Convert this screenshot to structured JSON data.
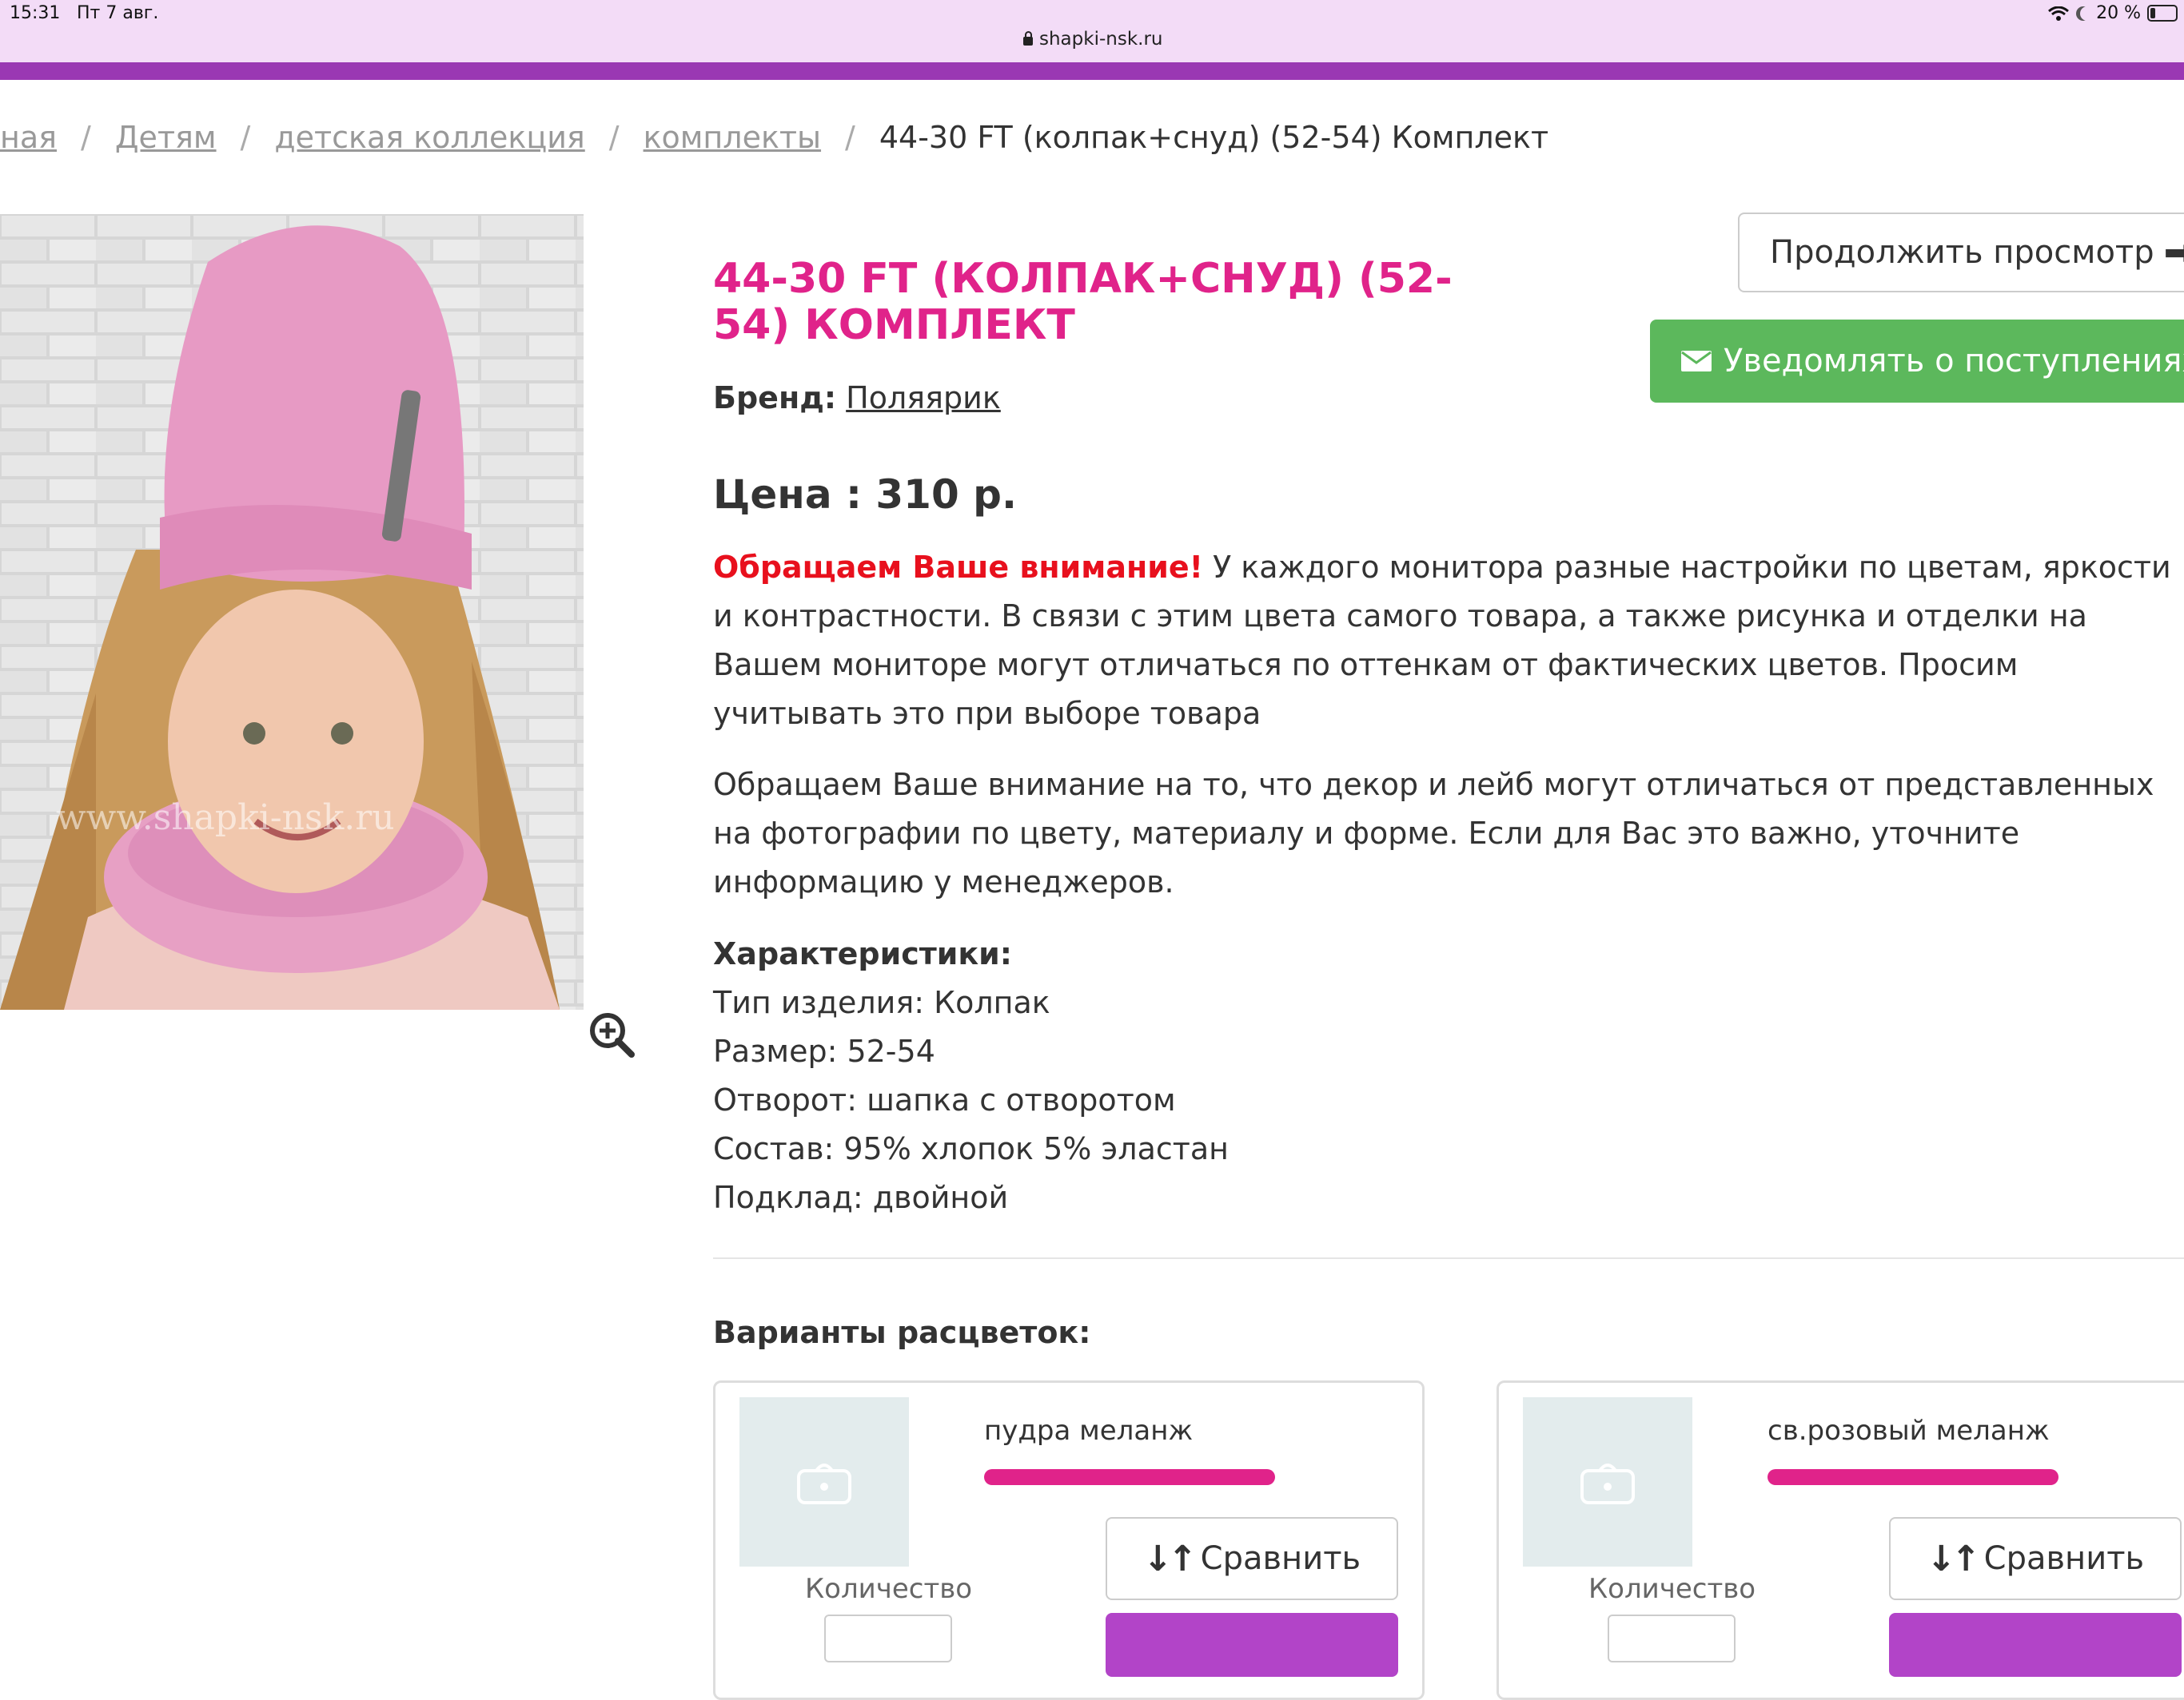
{
  "status_bar": {
    "time": "15:31",
    "date": "Пт 7 авг.",
    "battery": "20 %"
  },
  "browser": {
    "url": "shapki-nsk.ru"
  },
  "breadcrumb": {
    "items": [
      "ная",
      "Детям",
      "детская коллекция",
      "комплекты"
    ],
    "separator": "/",
    "current": "44-30 FT (колпак+снуд) (52-54) Комплект"
  },
  "product": {
    "title": "44-30 FT (КОЛПАК+СНУД) (52-54) КОМПЛЕКТ",
    "brand_label": "Бренд:",
    "brand_value": "Поляярик",
    "price": "Цена : 310 р.",
    "photo_watermark": "www.shapki-nsk.ru"
  },
  "buttons": {
    "continue": "Продолжить просмотр",
    "notify": "Уведомлять о поступлениях"
  },
  "notice": {
    "highlight": "Обращаем Ваше внимание!",
    "text": " У каждого монитора разные настройки по цветам, яркости и контрастности. В связи с этим цвета самого товара, а также рисунка и отделки на Вашем мониторе могут отличаться по оттенкам от фактических цветов. Просим учитывать это при выборе товара",
    "text2": "Обращаем Ваше внимание на то, что декор и лейб могут отличаться от представленных на фотографии по цвету, материалу и форме. Если для Вас это важно, уточните информацию у менеджеров."
  },
  "specs": {
    "heading": "Характеристики:",
    "items": [
      "Тип изделия: Колпак",
      "Размер: 52-54",
      "Отворот: шапка с отворотом",
      "Состав: 95% хлопок 5% эластан",
      "Подклад: двойной"
    ]
  },
  "variants": {
    "title": "Варианты расцветок:",
    "cards": [
      {
        "name": "пудра меланж",
        "qty_label": "Количество",
        "compare": "Сравнить"
      },
      {
        "name": "св.розовый меланж",
        "qty_label": "Количество",
        "compare": "Сравнить"
      }
    ]
  },
  "colors": {
    "accent": "#e0238a",
    "purple": "#9a38b3",
    "green": "#5cb85c",
    "red": "#e8101d"
  }
}
